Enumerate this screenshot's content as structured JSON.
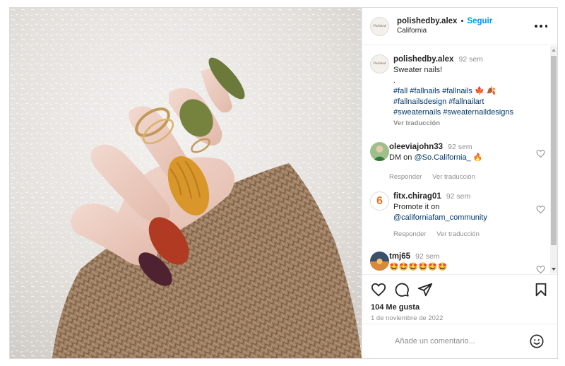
{
  "post_header": {
    "username": "polishedby.alex",
    "separator": "•",
    "follow_label": "Seguir",
    "location": "California",
    "avatar_text": "Polished"
  },
  "caption": {
    "username": "polishedby.alex",
    "time": "92 sem",
    "text": "Sweater nails!",
    "dot": ".",
    "hashtags_line1": "#fall #fallnails #fallnails 🍁 🍂",
    "hashtags_line2": "#fallnailsdesign #fallnailart",
    "hashtags_line3": "#sweaternails #sweaternaildesigns",
    "translate_label": "Ver traducción"
  },
  "comments": [
    {
      "username": "oleeviajohn33",
      "time": "92 sem",
      "text_prefix": "DM on ",
      "mention": "@So.California_",
      "text_suffix": " 🔥",
      "reply_label": "Responder",
      "translate_label": "Ver traducción"
    },
    {
      "username": "fitx.chirag01",
      "time": "92 sem",
      "text_prefix": "Promote it on",
      "mention": "@californiafam_community",
      "avatar_text": "6",
      "reply_label": "Responder",
      "translate_label": "Ver traducción"
    },
    {
      "username": "tmj65",
      "time": "92 sem",
      "text": "🤩🤩🤩🤩🤩🤩"
    }
  ],
  "actions": {
    "likes": "104 Me gusta",
    "date": "1 de noviembre de 2022"
  },
  "comment_box": {
    "placeholder": "Añade un comentario..."
  },
  "colors": {
    "link_blue": "#0095f6",
    "hashtag_blue": "#00376b",
    "muted": "#8e8e8e",
    "nail_green": "#6b7a3a",
    "nail_mustard": "#d9962a",
    "nail_rust": "#b03a22",
    "nail_burgundy": "#4e2230",
    "sweater_tan": "#a7876a"
  }
}
